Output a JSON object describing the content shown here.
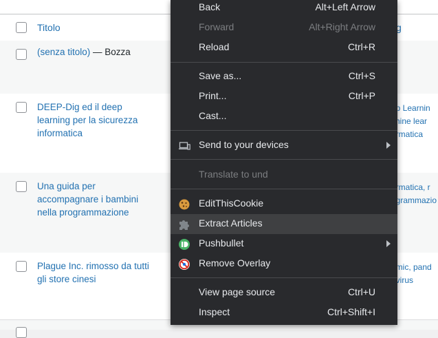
{
  "table": {
    "header": {
      "title_label": "Titolo",
      "right_fragment": "g"
    },
    "rows": [
      {
        "title": "(senza titolo)",
        "status": " — Bozza",
        "right": []
      },
      {
        "title": "DEEP-Dig ed il deep learning per la sicurezza informatica",
        "status": "",
        "right": [
          "ep Learnin",
          "chine lear",
          "ormatica"
        ]
      },
      {
        "title": "Una guida per accompagnare i bambini nella programmazione",
        "status": "",
        "right": [
          "ormatica, r",
          "ogrammazio",
          ""
        ]
      },
      {
        "title": "Plague Inc. rimosso da tutti gli store cinesi",
        "status": "",
        "right": [
          "emic, pand",
          ", virus",
          ""
        ]
      }
    ]
  },
  "context_menu": {
    "back": {
      "label": "Back",
      "shortcut": "Alt+Left Arrow"
    },
    "forward": {
      "label": "Forward",
      "shortcut": "Alt+Right Arrow"
    },
    "reload": {
      "label": "Reload",
      "shortcut": "Ctrl+R"
    },
    "save_as": {
      "label": "Save as...",
      "shortcut": "Ctrl+S"
    },
    "print": {
      "label": "Print...",
      "shortcut": "Ctrl+P"
    },
    "cast": {
      "label": "Cast..."
    },
    "send_to_devices": {
      "label": "Send to your devices",
      "icon": "devices-icon"
    },
    "translate": {
      "label": "Translate to und"
    },
    "edit_this_cookie": {
      "label": "EditThisCookie",
      "icon": "cookie-icon"
    },
    "extract_articles": {
      "label": "Extract Articles",
      "icon": "puzzle-icon"
    },
    "pushbullet": {
      "label": "Pushbullet",
      "icon": "pushbullet-icon"
    },
    "remove_overlay": {
      "label": "Remove Overlay",
      "icon": "no-entry-icon"
    },
    "view_source": {
      "label": "View page source",
      "shortcut": "Ctrl+U"
    },
    "inspect": {
      "label": "Inspect",
      "shortcut": "Ctrl+Shift+I"
    }
  },
  "colors": {
    "menu_bg": "#292a2d",
    "menu_hover": "#3f4042",
    "link": "#2271b1"
  }
}
